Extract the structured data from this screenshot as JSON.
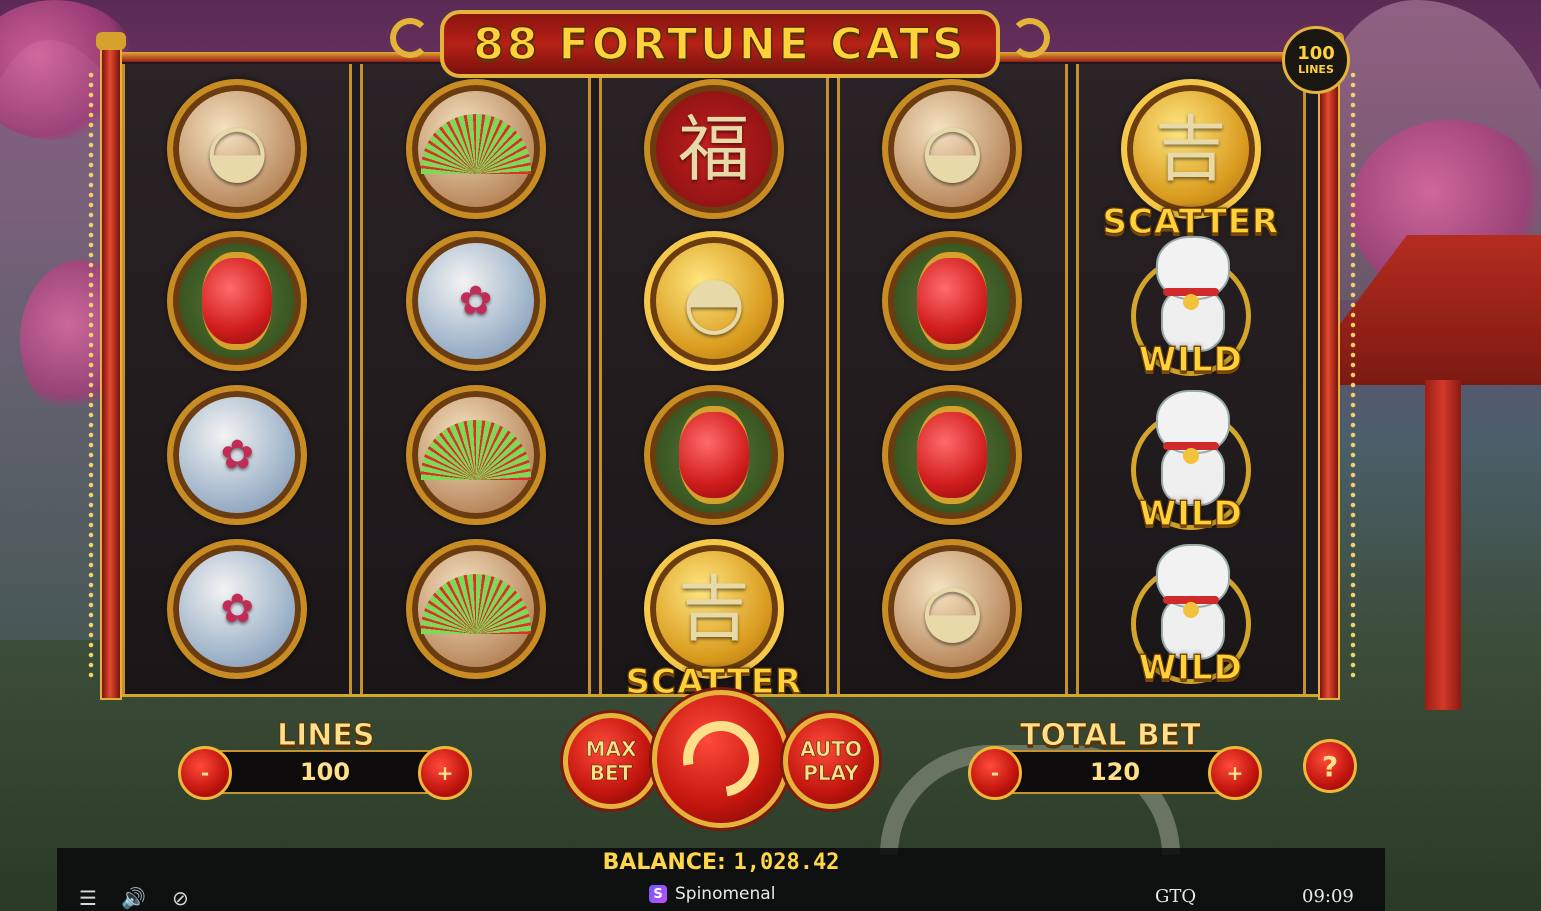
{
  "title": "88 FORTUNE CATS",
  "lines_badge": {
    "number": "100",
    "label": "LINES"
  },
  "reels": [
    [
      {
        "symbol": "dumpling-basket",
        "style": "warm",
        "glyph": "◒"
      },
      {
        "symbol": "red-lantern",
        "style": "green"
      },
      {
        "symbol": "cherry-blossom",
        "style": "sky",
        "glyph": "✿"
      },
      {
        "symbol": "cherry-blossom",
        "style": "sky",
        "glyph": "✿"
      }
    ],
    [
      {
        "symbol": "green-fan",
        "style": "warm"
      },
      {
        "symbol": "cherry-blossom",
        "style": "sky",
        "glyph": "✿"
      },
      {
        "symbol": "green-fan",
        "style": "warm"
      },
      {
        "symbol": "green-fan",
        "style": "warm"
      }
    ],
    [
      {
        "symbol": "red-pouch",
        "style": "red",
        "glyph": "福"
      },
      {
        "symbol": "gold-ingot",
        "style": "gold",
        "glyph": "◓"
      },
      {
        "symbol": "red-lantern",
        "style": "green"
      },
      {
        "symbol": "gold-coin",
        "style": "gold",
        "glyph": "吉",
        "label": "SCATTER"
      }
    ],
    [
      {
        "symbol": "dumpling-basket",
        "style": "warm",
        "glyph": "◒"
      },
      {
        "symbol": "red-lantern",
        "style": "green"
      },
      {
        "symbol": "red-lantern",
        "style": "green"
      },
      {
        "symbol": "dumpling-basket",
        "style": "warm",
        "glyph": "◒"
      }
    ],
    [
      {
        "symbol": "gold-coin",
        "style": "gold",
        "glyph": "吉",
        "label": "SCATTER"
      },
      {
        "symbol": "lucky-cat",
        "label": "WILD"
      },
      {
        "symbol": "lucky-cat",
        "label": "WILD"
      },
      {
        "symbol": "lucky-cat",
        "label": "WILD"
      }
    ]
  ],
  "controls": {
    "lines_label": "LINES",
    "lines_value": "100",
    "minus": "-",
    "plus": "+",
    "max_bet": "MAX\nBET",
    "auto_play": "AUTO\nPLAY",
    "total_bet_label": "TOTAL BET",
    "total_bet_value": "120",
    "help": "?"
  },
  "status_bar": {
    "balance_label": "BALANCE:",
    "balance_value": "1,028.42",
    "brand": "Spinomenal",
    "currency": "GTQ",
    "time": "09:09"
  },
  "colors": {
    "gold": "#ffd23a",
    "red": "#c0140d",
    "frame": "#d4a52b"
  }
}
